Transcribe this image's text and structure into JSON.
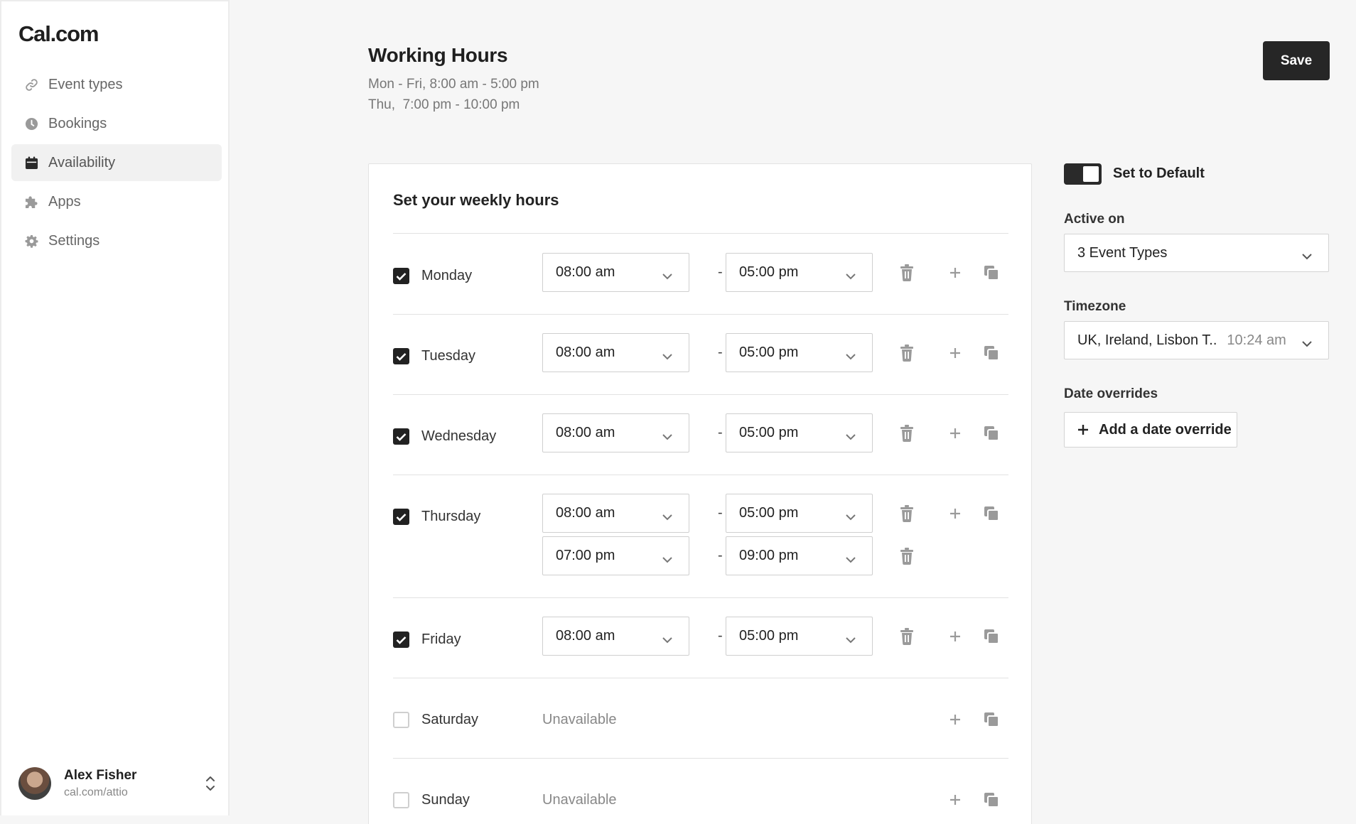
{
  "app": {
    "logo": "Cal.com"
  },
  "sidebar": {
    "items": [
      {
        "label": "Event types",
        "icon": "link-icon"
      },
      {
        "label": "Bookings",
        "icon": "clock-icon"
      },
      {
        "label": "Availability",
        "icon": "calendar-icon",
        "active": true
      },
      {
        "label": "Apps",
        "icon": "puzzle-icon"
      },
      {
        "label": "Settings",
        "icon": "gear-icon"
      }
    ],
    "profile": {
      "name": "Alex Fisher",
      "handle": "cal.com/attio"
    }
  },
  "header": {
    "title": "Working Hours",
    "summary_line1": "Mon - Fri, 8:00 am - 5:00 pm",
    "summary_line2": "Thu,  7:00 pm - 10:00 pm",
    "save_label": "Save"
  },
  "weekly": {
    "title": "Set your weekly hours",
    "separator": "-",
    "unavailable_label": "Unavailable",
    "days": [
      {
        "name": "Monday",
        "enabled": true,
        "ranges": [
          {
            "start": "08:00 am",
            "end": "05:00 pm"
          }
        ]
      },
      {
        "name": "Tuesday",
        "enabled": true,
        "ranges": [
          {
            "start": "08:00 am",
            "end": "05:00 pm"
          }
        ]
      },
      {
        "name": "Wednesday",
        "enabled": true,
        "ranges": [
          {
            "start": "08:00 am",
            "end": "05:00 pm"
          }
        ]
      },
      {
        "name": "Thursday",
        "enabled": true,
        "ranges": [
          {
            "start": "08:00 am",
            "end": "05:00 pm"
          },
          {
            "start": "07:00 pm",
            "end": "09:00 pm"
          }
        ]
      },
      {
        "name": "Friday",
        "enabled": true,
        "ranges": [
          {
            "start": "08:00 am",
            "end": "05:00 pm"
          }
        ]
      },
      {
        "name": "Saturday",
        "enabled": false,
        "ranges": []
      },
      {
        "name": "Sunday",
        "enabled": false,
        "ranges": []
      }
    ]
  },
  "settings": {
    "default_toggle_label": "Set to Default",
    "default_toggle_on": true,
    "active_on_label": "Active on",
    "active_on_value": "3 Event Types",
    "timezone_label": "Timezone",
    "timezone_value": "UK, Ireland, Lisbon T..",
    "timezone_time": "10:24 am",
    "date_overrides_label": "Date overrides",
    "add_override_label": "Add a date override"
  },
  "colors": {
    "primary": "#262626",
    "background": "#f6f6f6",
    "muted_text": "#888888"
  }
}
